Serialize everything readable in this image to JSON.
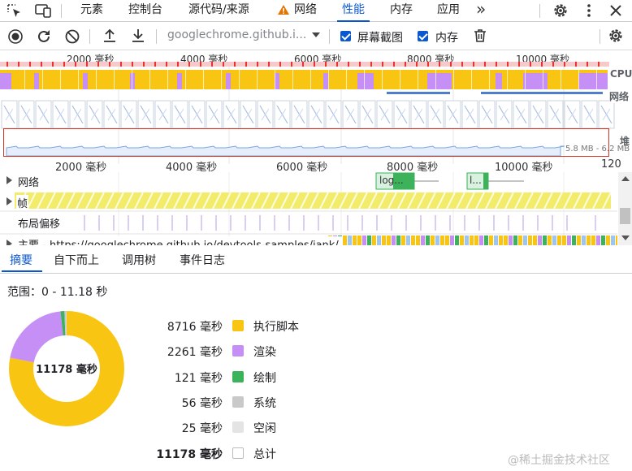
{
  "tabbar": {
    "tabs": [
      {
        "label": "元素"
      },
      {
        "label": "控制台"
      },
      {
        "label": "源代码/来源"
      },
      {
        "label": "网络"
      },
      {
        "label": "性能"
      },
      {
        "label": "内存"
      },
      {
        "label": "应用"
      }
    ],
    "active_tab": "性能",
    "more_glyph": "»",
    "colors": {
      "accent": "#0b57d0",
      "warning": "#e37400"
    }
  },
  "toolbar": {
    "url": "googlechrome.github.i...",
    "screenshots_label": "屏幕截图",
    "screenshots_checked": true,
    "memory_label": "内存",
    "memory_checked": true
  },
  "overview": {
    "ticks": [
      "2000 毫秒",
      "4000 毫秒",
      "6000 毫秒",
      "8000 毫秒",
      "10000 毫秒"
    ],
    "cpu_label": "CPU",
    "network_label": "网络",
    "heap_label": "堆",
    "heap_range": "5.8 MB - 6.2 MB",
    "colors": {
      "scripting": "#f9c513",
      "rendering": "#c68ff5",
      "long_task": "#e8322a",
      "network": "#4f7fcc",
      "heap": "#7ba6e0"
    }
  },
  "ruler": {
    "ticks": [
      "2000 毫秒",
      "4000 毫秒",
      "6000 毫秒",
      "8000 毫秒",
      "10000 毫秒",
      "120"
    ]
  },
  "tracks": {
    "network_label": "网络",
    "network_items": [
      "log...",
      "l..."
    ],
    "frames_label": "帧",
    "layout_shift_label": "布局偏移",
    "main_label": "主要 - https://googlechrome.github.io/devtools-samples/jank/"
  },
  "subtabs": [
    "摘要",
    "自下而上",
    "调用树",
    "事件日志"
  ],
  "summary": {
    "range_label": "范围：0 - 11.18 秒",
    "total_center": "11178 毫秒",
    "rows": [
      {
        "value": "8716 毫秒",
        "label": "执行脚本",
        "color": "#f9c513"
      },
      {
        "value": "2261 毫秒",
        "label": "渲染",
        "color": "#c68ff5"
      },
      {
        "value": "121 毫秒",
        "label": "绘制",
        "color": "#3cb25a"
      },
      {
        "value": "56 毫秒",
        "label": "系统",
        "color": "#c9c9c9"
      },
      {
        "value": "25 毫秒",
        "label": "空闲",
        "color": "#e4e4e4"
      },
      {
        "value": "11178 毫秒",
        "label": "总计",
        "color": "#ffffff"
      }
    ],
    "donut_values": [
      8716,
      2261,
      121,
      56,
      25
    ]
  },
  "watermark": "@稀土掘金技术社区"
}
